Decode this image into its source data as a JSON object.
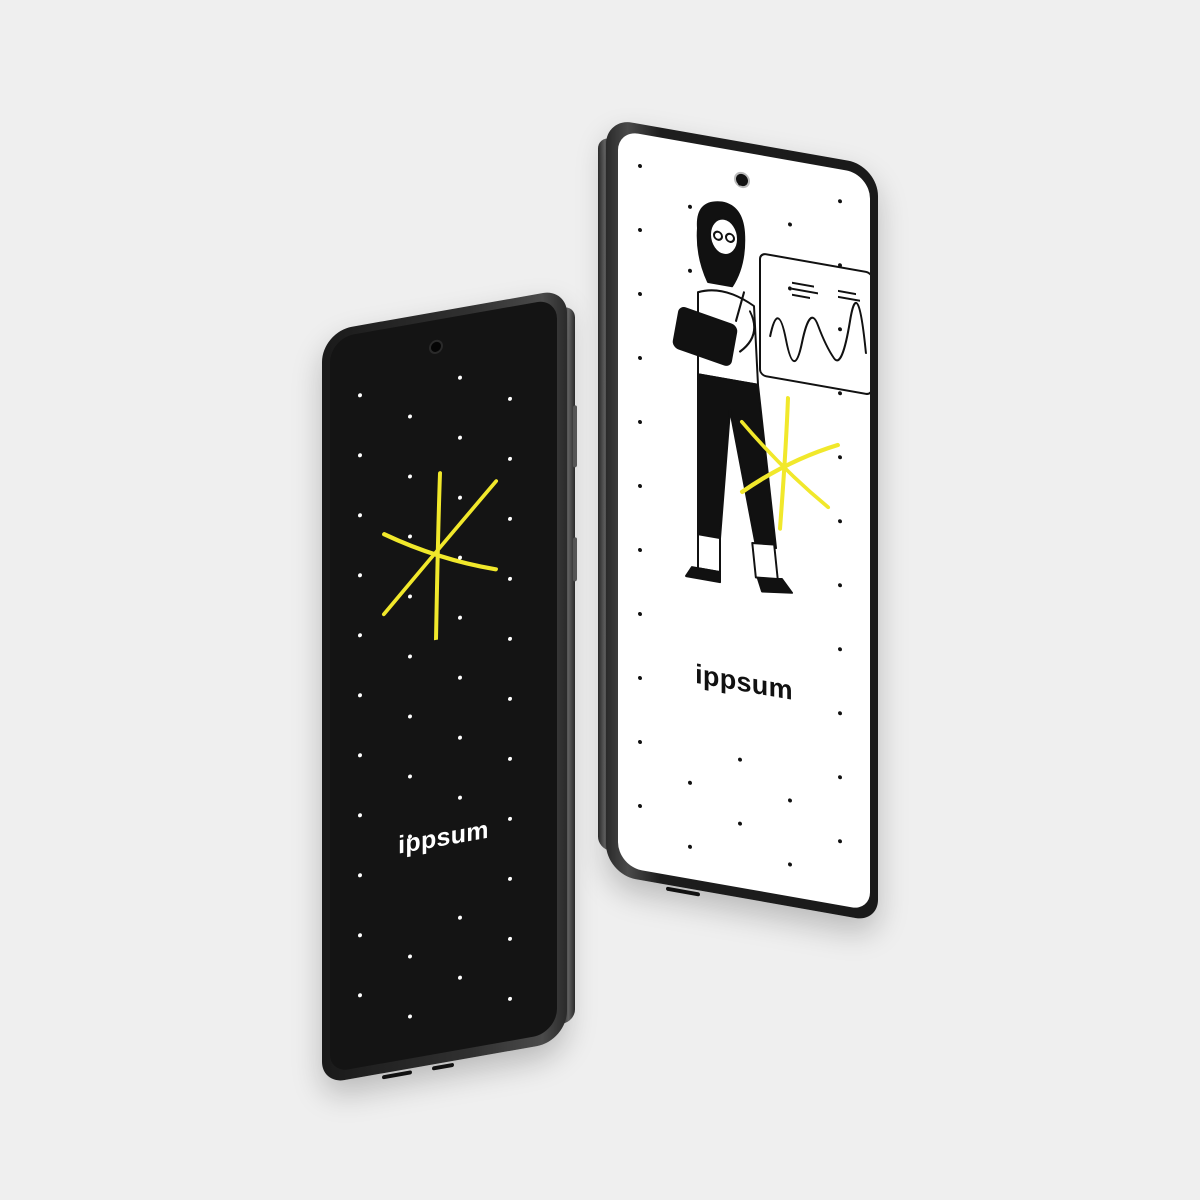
{
  "colors": {
    "background": "#efefef",
    "accent": "#f1e82b",
    "dark_screen": "#141414",
    "light_screen": "#ffffff"
  },
  "devices": [
    {
      "id": "phone-dark",
      "screen_theme": "dark",
      "brand_text": "ippsum",
      "graphic": "yellow-asterisk-icon"
    },
    {
      "id": "phone-light",
      "screen_theme": "light",
      "brand_text": "ippsum",
      "graphic": "woman-with-tablet-illustration"
    }
  ]
}
